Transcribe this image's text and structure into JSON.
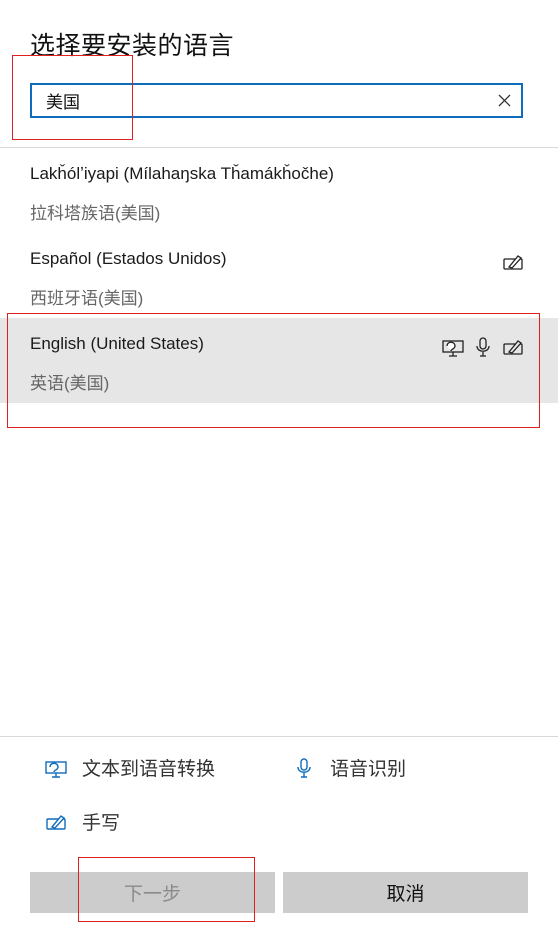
{
  "dialog": {
    "title": "选择要安装的语言"
  },
  "search": {
    "value": "美国"
  },
  "languages": [
    {
      "name": "Lakȟólʼiyapi (Mílahaŋska Tȟamákȟočhe)",
      "native": "拉科塔族语(美国)",
      "features": []
    },
    {
      "name": "Español (Estados Unidos)",
      "native": "西班牙语(美国)",
      "features": [
        "handwriting-icon"
      ]
    },
    {
      "name": "English (United States)",
      "native": "英语(美国)",
      "features": [
        "text-to-speech-icon",
        "microphone-icon",
        "handwriting-icon"
      ],
      "selected": true
    }
  ],
  "legend": {
    "tts": "文本到语音转换",
    "speech": "语音识别",
    "handwriting": "手写"
  },
  "buttons": {
    "next": "下一步",
    "cancel": "取消"
  },
  "colors": {
    "accent": "#0f6cbd",
    "highlight": "#e02020",
    "selected_bg": "#e6e6e6",
    "button_bg": "#cccccc"
  }
}
